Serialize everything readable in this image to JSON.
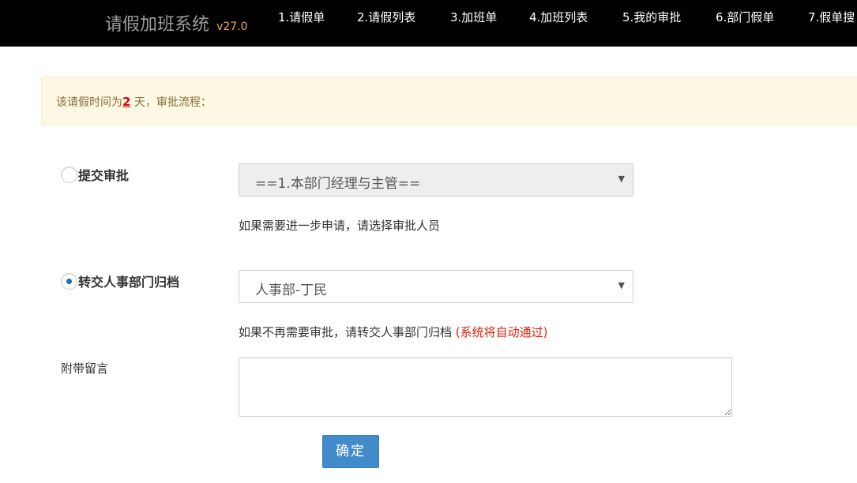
{
  "navbar": {
    "brand_title": "请假加班系统",
    "brand_version": "v27.0",
    "items": [
      {
        "label": "1.请假单"
      },
      {
        "label": "2.请假列表"
      },
      {
        "label": "3.加班单"
      },
      {
        "label": "4.加班列表"
      },
      {
        "label": "5.我的审批"
      },
      {
        "label": "6.部门假单"
      },
      {
        "label": "7.假单搜"
      }
    ]
  },
  "alert": {
    "prefix": "该请假时间为",
    "days": "2",
    "suffix": " 天，审批流程："
  },
  "submit_option": {
    "label": "提交审批",
    "checked": false,
    "select_value": "==1.本部门经理与主管==",
    "help": "如果需要进一步申请，请选择审批人员"
  },
  "transfer_option": {
    "label": "转交人事部门归档",
    "checked": true,
    "select_value": "人事部-丁民",
    "help": "如果不再需要审批，请转交人事部门归档",
    "help_note": "(系统将自动通过)"
  },
  "message": {
    "label": "附带留言",
    "value": ""
  },
  "submit_button": {
    "label": "确定"
  },
  "colors": {
    "navbar_bg": "#000000",
    "version": "#f0ad4e",
    "alert_bg": "#fcf8e3",
    "alert_text": "#8a6d3b",
    "days": "#e00000",
    "help_note": "#d9230f",
    "primary_button": "#428bca",
    "radio_dot": "#1e6bb8"
  }
}
